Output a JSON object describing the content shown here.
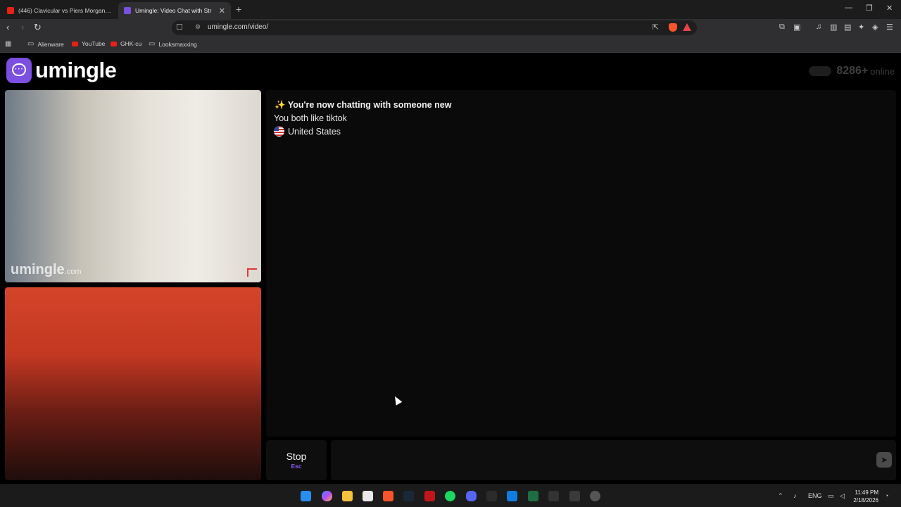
{
  "browser": {
    "tabs": [
      {
        "label": "(446) Clavicular vs Piers Morgan: HEA",
        "active": false
      },
      {
        "label": "Umingle: Video Chat with Str",
        "active": true
      }
    ],
    "new_tab": "+",
    "url": "umingle.com/video/",
    "bookmarks": [
      "Alienware",
      "YouTube",
      "GHK-cu",
      "Looksmaxxing"
    ]
  },
  "page": {
    "logo_text": "umingle",
    "online_count": "8286+",
    "online_label": "online",
    "video_watermark": {
      "main": "umingle",
      "suffix": ".com"
    },
    "chat": {
      "emoji": "✨",
      "status": "You're now chatting with someone new",
      "interests": "You both like tiktok",
      "country": "United States"
    },
    "stop_button": {
      "label": "Stop",
      "shortcut": "Esc"
    },
    "message_placeholder": ""
  },
  "taskbar": {
    "language": "ENG",
    "time": "11:49 PM",
    "date": "2/18/2026"
  },
  "colors": {
    "brand": "#7b4fe0",
    "shortcut": "#8b5cf6",
    "report_flag": "#e03838"
  }
}
